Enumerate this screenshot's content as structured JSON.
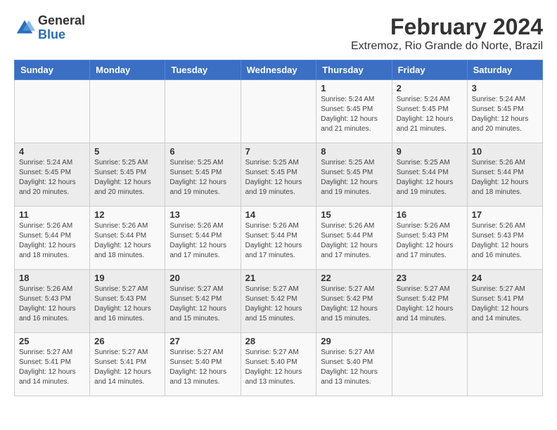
{
  "logo": {
    "general": "General",
    "blue": "Blue"
  },
  "title": "February 2024",
  "subtitle": "Extremoz, Rio Grande do Norte, Brazil",
  "days_of_week": [
    "Sunday",
    "Monday",
    "Tuesday",
    "Wednesday",
    "Thursday",
    "Friday",
    "Saturday"
  ],
  "weeks": [
    [
      {
        "day": "",
        "info": ""
      },
      {
        "day": "",
        "info": ""
      },
      {
        "day": "",
        "info": ""
      },
      {
        "day": "",
        "info": ""
      },
      {
        "day": "1",
        "sunrise": "5:24 AM",
        "sunset": "5:45 PM",
        "daylight": "12 hours and 21 minutes."
      },
      {
        "day": "2",
        "sunrise": "5:24 AM",
        "sunset": "5:45 PM",
        "daylight": "12 hours and 21 minutes."
      },
      {
        "day": "3",
        "sunrise": "5:24 AM",
        "sunset": "5:45 PM",
        "daylight": "12 hours and 20 minutes."
      }
    ],
    [
      {
        "day": "4",
        "sunrise": "5:24 AM",
        "sunset": "5:45 PM",
        "daylight": "12 hours and 20 minutes."
      },
      {
        "day": "5",
        "sunrise": "5:25 AM",
        "sunset": "5:45 PM",
        "daylight": "12 hours and 20 minutes."
      },
      {
        "day": "6",
        "sunrise": "5:25 AM",
        "sunset": "5:45 PM",
        "daylight": "12 hours and 19 minutes."
      },
      {
        "day": "7",
        "sunrise": "5:25 AM",
        "sunset": "5:45 PM",
        "daylight": "12 hours and 19 minutes."
      },
      {
        "day": "8",
        "sunrise": "5:25 AM",
        "sunset": "5:45 PM",
        "daylight": "12 hours and 19 minutes."
      },
      {
        "day": "9",
        "sunrise": "5:25 AM",
        "sunset": "5:44 PM",
        "daylight": "12 hours and 19 minutes."
      },
      {
        "day": "10",
        "sunrise": "5:26 AM",
        "sunset": "5:44 PM",
        "daylight": "12 hours and 18 minutes."
      }
    ],
    [
      {
        "day": "11",
        "sunrise": "5:26 AM",
        "sunset": "5:44 PM",
        "daylight": "12 hours and 18 minutes."
      },
      {
        "day": "12",
        "sunrise": "5:26 AM",
        "sunset": "5:44 PM",
        "daylight": "12 hours and 18 minutes."
      },
      {
        "day": "13",
        "sunrise": "5:26 AM",
        "sunset": "5:44 PM",
        "daylight": "12 hours and 17 minutes."
      },
      {
        "day": "14",
        "sunrise": "5:26 AM",
        "sunset": "5:44 PM",
        "daylight": "12 hours and 17 minutes."
      },
      {
        "day": "15",
        "sunrise": "5:26 AM",
        "sunset": "5:44 PM",
        "daylight": "12 hours and 17 minutes."
      },
      {
        "day": "16",
        "sunrise": "5:26 AM",
        "sunset": "5:43 PM",
        "daylight": "12 hours and 17 minutes."
      },
      {
        "day": "17",
        "sunrise": "5:26 AM",
        "sunset": "5:43 PM",
        "daylight": "12 hours and 16 minutes."
      }
    ],
    [
      {
        "day": "18",
        "sunrise": "5:26 AM",
        "sunset": "5:43 PM",
        "daylight": "12 hours and 16 minutes."
      },
      {
        "day": "19",
        "sunrise": "5:27 AM",
        "sunset": "5:43 PM",
        "daylight": "12 hours and 16 minutes."
      },
      {
        "day": "20",
        "sunrise": "5:27 AM",
        "sunset": "5:42 PM",
        "daylight": "12 hours and 15 minutes."
      },
      {
        "day": "21",
        "sunrise": "5:27 AM",
        "sunset": "5:42 PM",
        "daylight": "12 hours and 15 minutes."
      },
      {
        "day": "22",
        "sunrise": "5:27 AM",
        "sunset": "5:42 PM",
        "daylight": "12 hours and 15 minutes."
      },
      {
        "day": "23",
        "sunrise": "5:27 AM",
        "sunset": "5:42 PM",
        "daylight": "12 hours and 14 minutes."
      },
      {
        "day": "24",
        "sunrise": "5:27 AM",
        "sunset": "5:41 PM",
        "daylight": "12 hours and 14 minutes."
      }
    ],
    [
      {
        "day": "25",
        "sunrise": "5:27 AM",
        "sunset": "5:41 PM",
        "daylight": "12 hours and 14 minutes."
      },
      {
        "day": "26",
        "sunrise": "5:27 AM",
        "sunset": "5:41 PM",
        "daylight": "12 hours and 14 minutes."
      },
      {
        "day": "27",
        "sunrise": "5:27 AM",
        "sunset": "5:40 PM",
        "daylight": "12 hours and 13 minutes."
      },
      {
        "day": "28",
        "sunrise": "5:27 AM",
        "sunset": "5:40 PM",
        "daylight": "12 hours and 13 minutes."
      },
      {
        "day": "29",
        "sunrise": "5:27 AM",
        "sunset": "5:40 PM",
        "daylight": "12 hours and 13 minutes."
      },
      {
        "day": "",
        "info": ""
      },
      {
        "day": "",
        "info": ""
      }
    ]
  ],
  "labels": {
    "sunrise": "Sunrise:",
    "sunset": "Sunset:",
    "daylight": "Daylight:"
  }
}
